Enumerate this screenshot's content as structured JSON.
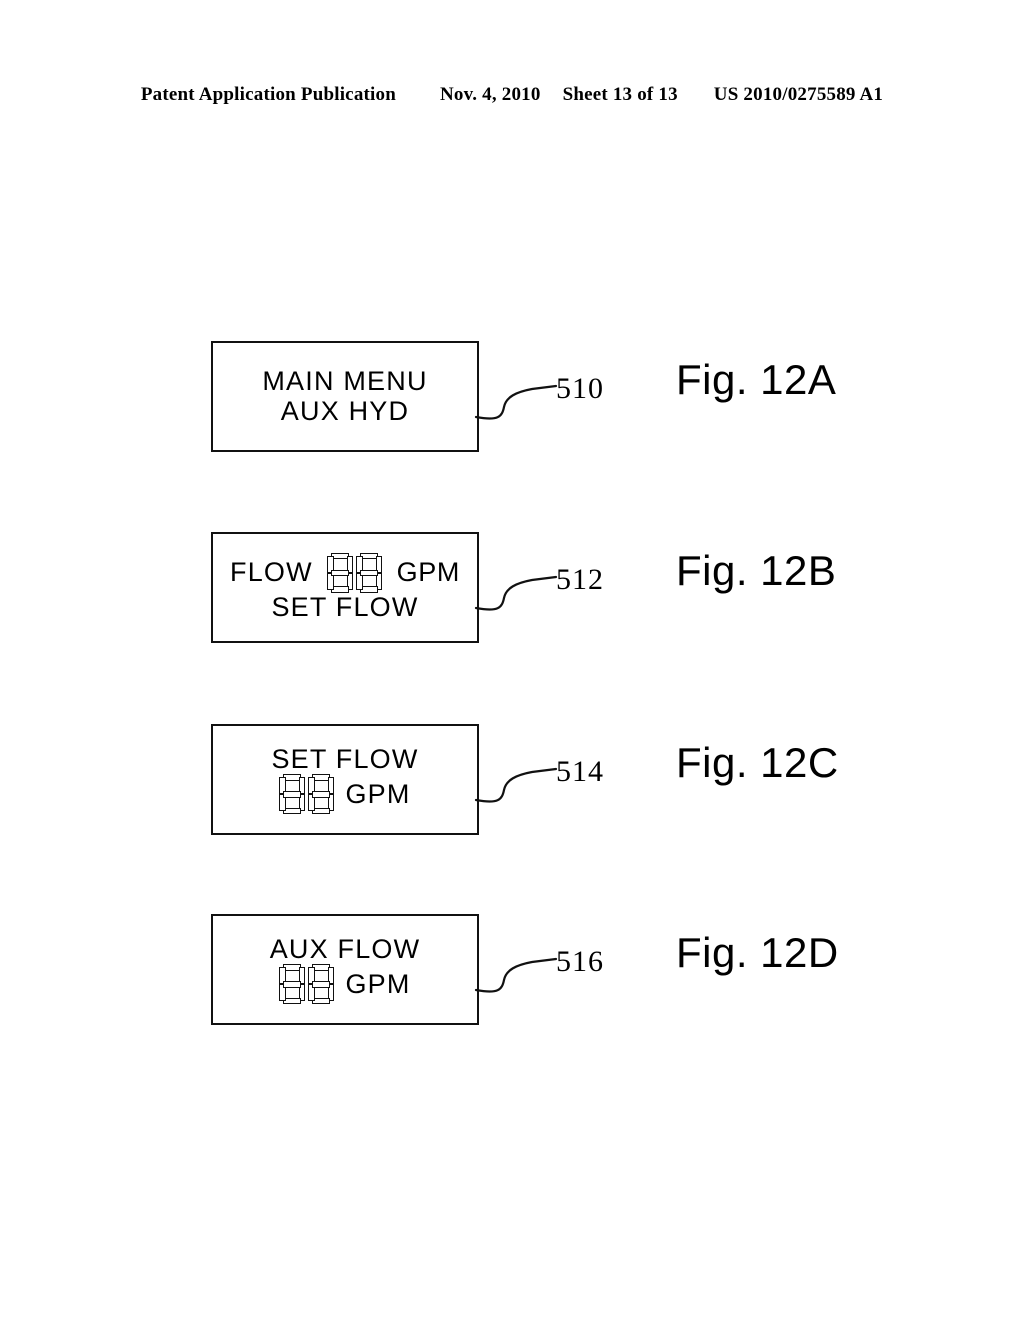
{
  "header": {
    "publication": "Patent Application Publication",
    "date": "Nov. 4, 2010",
    "sheet": "Sheet 13 of 13",
    "patent_number": "US 2010/0275589 A1"
  },
  "colors": {
    "ink": "#000000",
    "paper": "#ffffff",
    "box_border": "#111111"
  },
  "figures": [
    {
      "caption": "Fig. 12A",
      "ref": "510",
      "screen": {
        "line1": {
          "type": "text",
          "text": "MAIN MENU"
        },
        "line2": {
          "type": "text",
          "text": "AUX HYD"
        }
      }
    },
    {
      "caption": "Fig. 12B",
      "ref": "512",
      "screen": {
        "line1": {
          "type": "value-row",
          "left_label": "FLOW",
          "digits": "88",
          "unit": "GPM"
        },
        "line2": {
          "type": "text",
          "text": "SET FLOW"
        }
      }
    },
    {
      "caption": "Fig. 12C",
      "ref": "514",
      "screen": {
        "line1": {
          "type": "text",
          "text": "SET FLOW"
        },
        "line2": {
          "type": "value-row-centered",
          "digits": "88",
          "unit": "GPM"
        }
      }
    },
    {
      "caption": "Fig. 12D",
      "ref": "516",
      "screen": {
        "line1": {
          "type": "text",
          "text": "AUX FLOW"
        },
        "line2": {
          "type": "value-row-centered",
          "digits": "88",
          "unit": "GPM"
        }
      }
    }
  ]
}
